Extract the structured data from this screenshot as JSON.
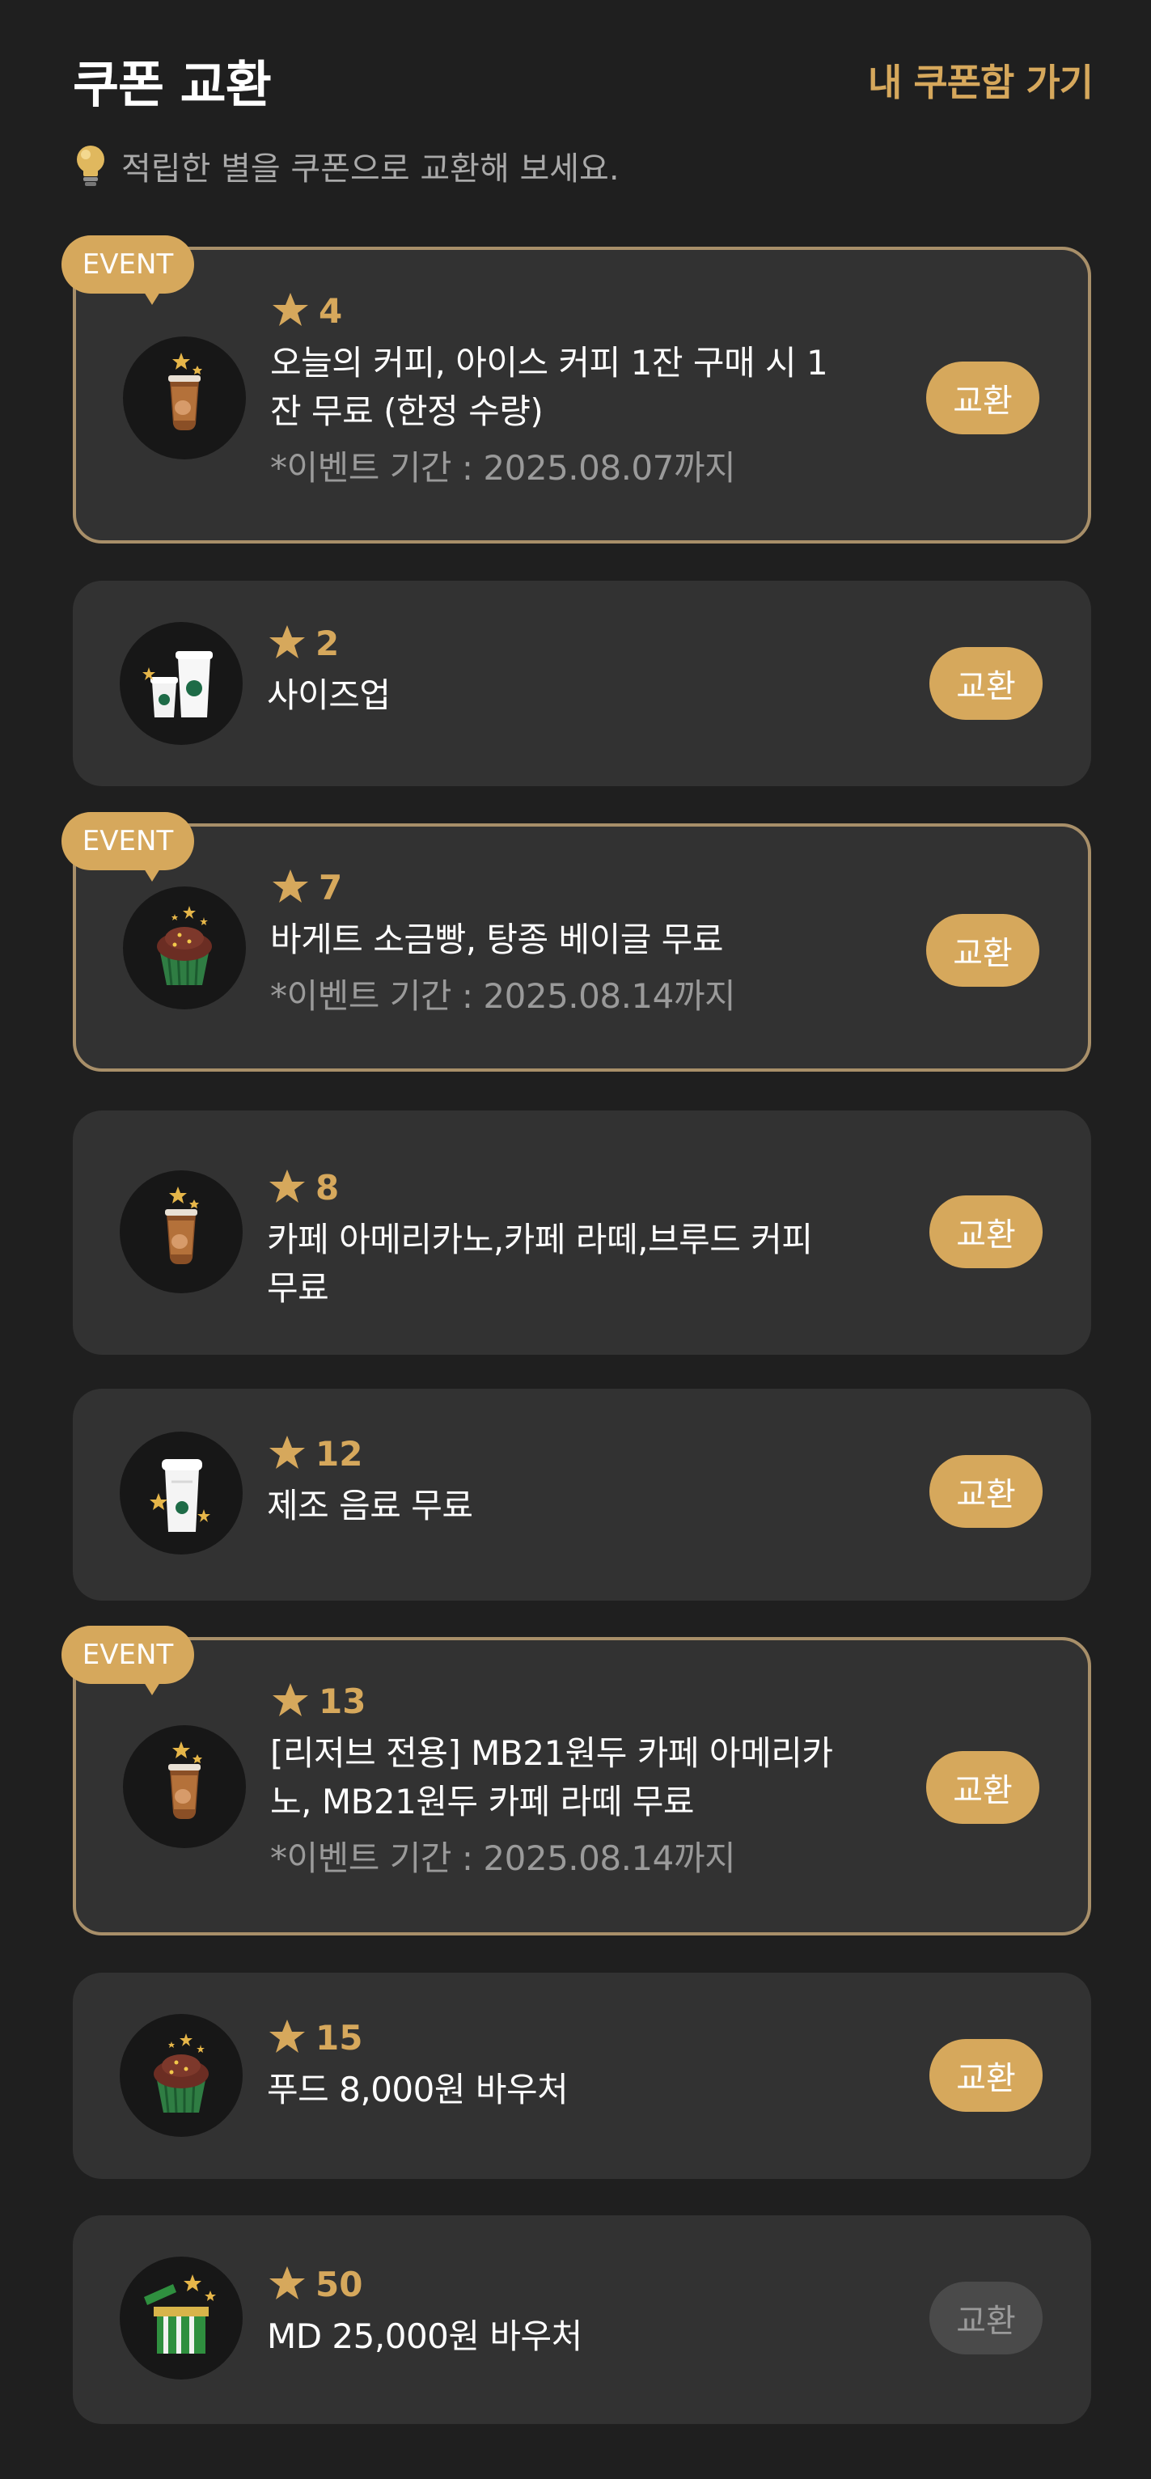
{
  "header": {
    "title": "쿠폰 교환",
    "my_coupons_link": "내 쿠폰함 가기"
  },
  "hint": {
    "icon": "lightbulb-icon",
    "text": "적립한 별을 쿠폰으로 교환해 보세요."
  },
  "colors": {
    "accent": "#d6a85c",
    "card_bg": "#323232",
    "page_bg": "#1f1f1f",
    "event_border": "#a88f69",
    "disabled_button": "#4a4a4a"
  },
  "coupons": [
    {
      "event_badge": "EVENT",
      "stars": "4",
      "name_lines": [
        "오늘의 커피, 아이스 커피 1잔 구매 시 1",
        "잔 무료 (한정 수량)"
      ],
      "period": "*이벤트 기간 : 2025.08.07까지",
      "image": "iced-coffee-icon",
      "button": "교환"
    },
    {
      "stars": "2",
      "name_lines": [
        "사이즈업"
      ],
      "image": "cups-size-up-icon",
      "button": "교환"
    },
    {
      "event_badge": "EVENT",
      "stars": "7",
      "name_lines": [
        "바게트 소금빵, 탕종 베이글 무료"
      ],
      "period": "*이벤트 기간 : 2025.08.14까지",
      "image": "cupcake-icon",
      "button": "교환"
    },
    {
      "stars": "8",
      "name_lines": [
        "카페 아메리카노,카페 라떼,브루드 커피",
        "무료"
      ],
      "image": "iced-coffee-icon",
      "button": "교환"
    },
    {
      "stars": "12",
      "name_lines": [
        "제조 음료 무료"
      ],
      "image": "frappuccino-cup-icon",
      "button": "교환"
    },
    {
      "event_badge": "EVENT",
      "stars": "13",
      "name_lines": [
        "[리저브 전용] MB21원두 카페 아메리카",
        "노, MB21원두 카페 라떼 무료"
      ],
      "period": "*이벤트 기간 : 2025.08.14까지",
      "image": "iced-coffee-icon",
      "button": "교환"
    },
    {
      "stars": "15",
      "name_lines": [
        "푸드 8,000원 바우처"
      ],
      "image": "cupcake-icon",
      "button": "교환"
    },
    {
      "stars": "50",
      "name_lines": [
        "MD 25,000원 바우처"
      ],
      "image": "gift-box-icon",
      "button": "교환",
      "button_disabled": true
    }
  ]
}
